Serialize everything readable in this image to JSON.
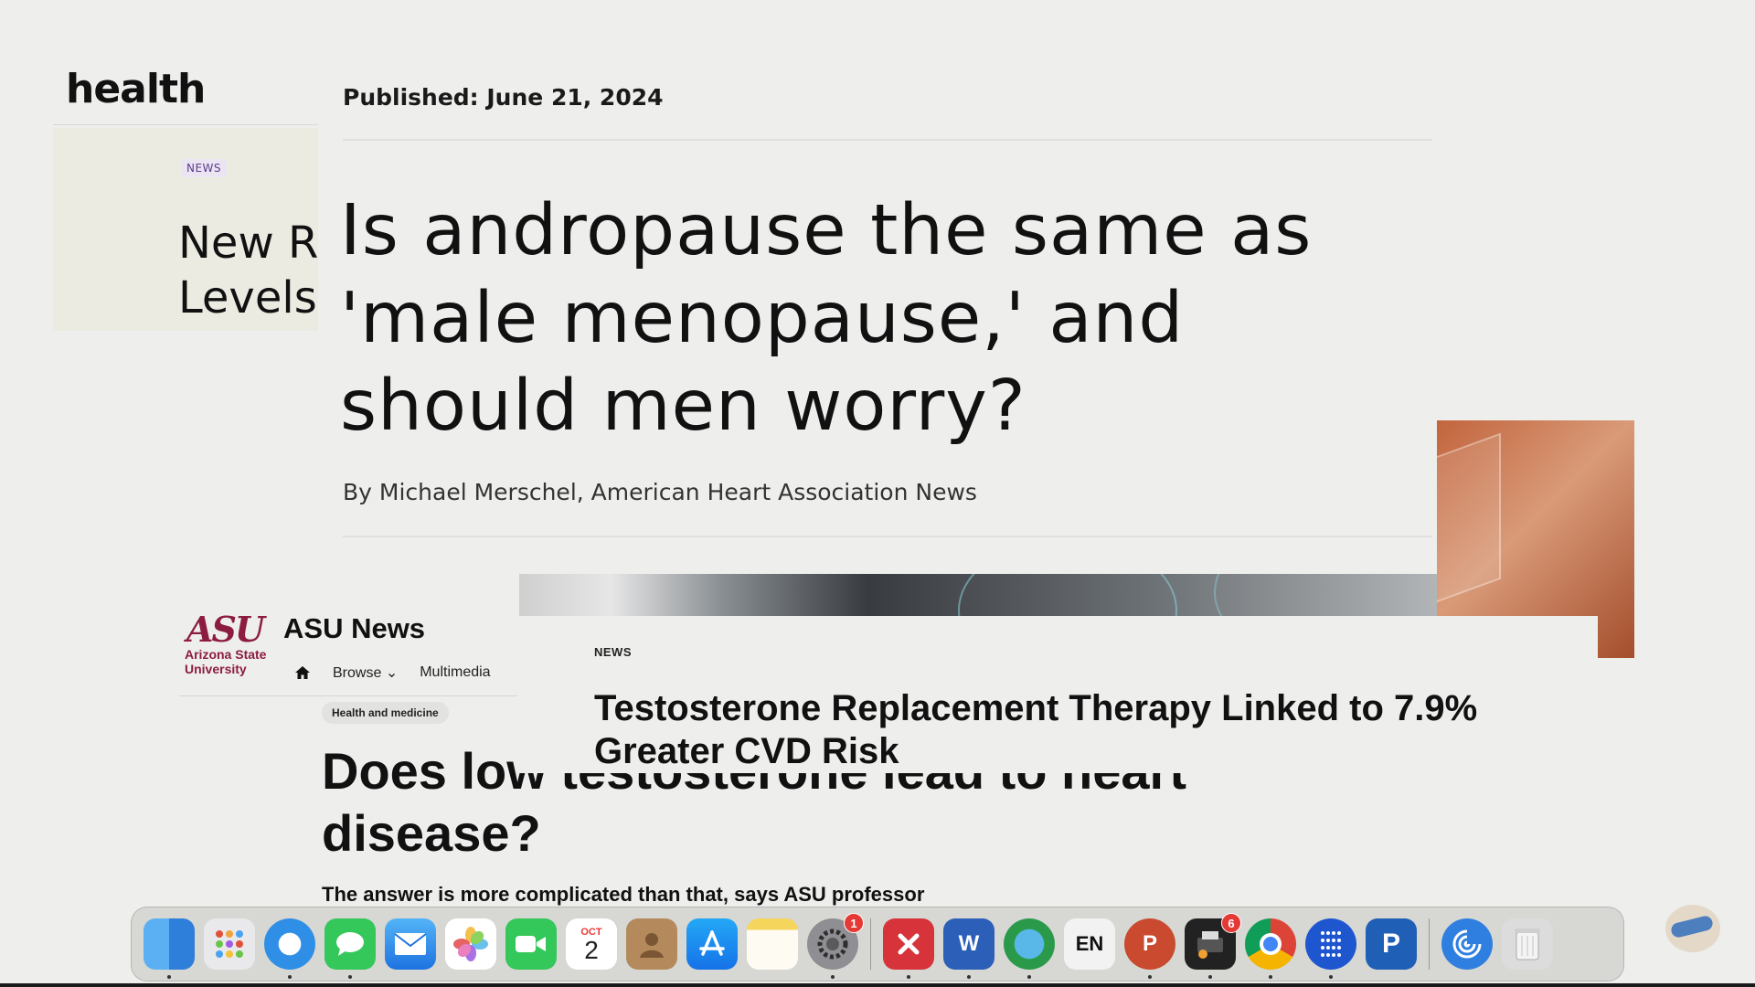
{
  "health_site": {
    "logo": "health",
    "tag": "NEWS",
    "cut_title_line1": "New R",
    "cut_title_line2": "Levels"
  },
  "aha_article": {
    "published": "Published: June 21, 2024",
    "title": "Is andropause the same as 'male menopause,' and should men worry?",
    "byline": "By Michael Merschel, American Heart Association News"
  },
  "asu_article": {
    "logo_mark": "ASU",
    "logo_text_line1": "Arizona State",
    "logo_text_line2": "University",
    "brand": "ASU News",
    "nav": {
      "browse": "Browse",
      "multimedia": "Multimedia"
    },
    "tag": "Health and medicine",
    "title": "Does low testosterone lead to heart disease?",
    "subtitle": "The answer is more complicated than that, says ASU professor"
  },
  "trt_article": {
    "tag": "NEWS",
    "title": "Testosterone Replacement Therapy Linked to 7.9% Greater CVD Risk"
  },
  "dock": {
    "calendar_month": "OCT",
    "calendar_day": "2",
    "settings_badge": "1",
    "printer_badge": "6",
    "word_letter": "W",
    "en_label": "EN",
    "ppt_letter": "P",
    "ps_letter": "P"
  }
}
